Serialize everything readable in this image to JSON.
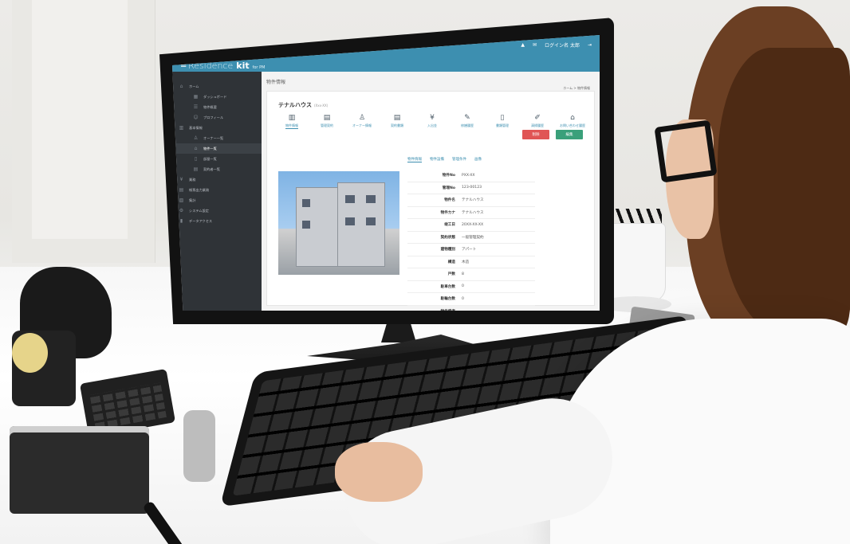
{
  "app": {
    "brand_main": "Residence",
    "brand_kit": "kit",
    "brand_suffix": "for PM",
    "user": "ログイン名 太郎",
    "breadcrumb": "ホーム > 物件情報",
    "page_title": "物件情報"
  },
  "sidebar": {
    "items": [
      {
        "label": "ホーム",
        "icon": "home-icon",
        "sub": false,
        "active": false
      },
      {
        "label": "ダッシュボード",
        "icon": "dashboard-icon",
        "sub": true,
        "active": false
      },
      {
        "label": "物件概要",
        "icon": "list-icon",
        "sub": true,
        "active": false
      },
      {
        "label": "プロフィール",
        "icon": "user-icon",
        "sub": true,
        "active": false
      },
      {
        "label": "基本情報",
        "icon": "building-icon",
        "sub": false,
        "active": false
      },
      {
        "label": "オーナー一覧",
        "icon": "person-icon",
        "sub": true,
        "active": false
      },
      {
        "label": "物件一覧",
        "icon": "home-list-icon",
        "sub": true,
        "active": true
      },
      {
        "label": "部屋一覧",
        "icon": "door-icon",
        "sub": true,
        "active": false
      },
      {
        "label": "契約者一覧",
        "icon": "contract-icon",
        "sub": true,
        "active": false
      },
      {
        "label": "業務",
        "icon": "yen-icon",
        "sub": false,
        "active": false
      },
      {
        "label": "帳票出力業務",
        "icon": "document-icon",
        "sub": false,
        "active": false
      },
      {
        "label": "集計",
        "icon": "chart-icon",
        "sub": false,
        "active": false
      },
      {
        "label": "システム設定",
        "icon": "gear-icon",
        "sub": false,
        "active": false
      },
      {
        "label": "データアクセス",
        "icon": "database-icon",
        "sub": false,
        "active": false
      }
    ]
  },
  "property": {
    "name": "テナルハウス",
    "sub": "(Xxx-XX)"
  },
  "tools": [
    {
      "label": "物件情報",
      "icon": "building-icon",
      "active": true
    },
    {
      "label": "管理契約",
      "icon": "contract-icon",
      "active": false
    },
    {
      "label": "オーナー情報",
      "icon": "person-icon",
      "active": false
    },
    {
      "label": "契約書類",
      "icon": "document-icon",
      "active": false
    },
    {
      "label": "入出金",
      "icon": "yen-icon",
      "active": false
    },
    {
      "label": "修繕履歴",
      "icon": "wrench-icon",
      "active": false
    },
    {
      "label": "書類管理",
      "icon": "file-icon",
      "active": false
    },
    {
      "label": "清掃履歴",
      "icon": "broom-icon",
      "active": false
    },
    {
      "label": "お問い合わせ履歴",
      "icon": "house-icon",
      "active": false
    }
  ],
  "buttons": {
    "delete": "削除",
    "edit": "編集"
  },
  "detail_tabs": [
    "物件情報",
    "物件設備",
    "管理条件",
    "画像"
  ],
  "details": [
    {
      "key": "物件No",
      "value": "PXX-XX"
    },
    {
      "key": "管理No",
      "value": "123-00123"
    },
    {
      "key": "物件名",
      "value": "テナルハウス"
    },
    {
      "key": "物件カナ",
      "value": "テナルハウス"
    },
    {
      "key": "竣工日",
      "value": "20XX-XX-XX"
    },
    {
      "key": "契約状態",
      "value": "一般管理契約"
    },
    {
      "key": "建物種別",
      "value": "アパート"
    },
    {
      "key": "構造",
      "value": "木造"
    },
    {
      "key": "戸数",
      "value": "8"
    },
    {
      "key": "駐車台数",
      "value": "0"
    },
    {
      "key": "駐輪台数",
      "value": "0"
    },
    {
      "key": "物件備考",
      "value": ""
    }
  ],
  "colors": {
    "topbar": "#3d8fb0",
    "sidebar": "#2f3337",
    "delete": "#e05555",
    "edit": "#3aa07a"
  }
}
